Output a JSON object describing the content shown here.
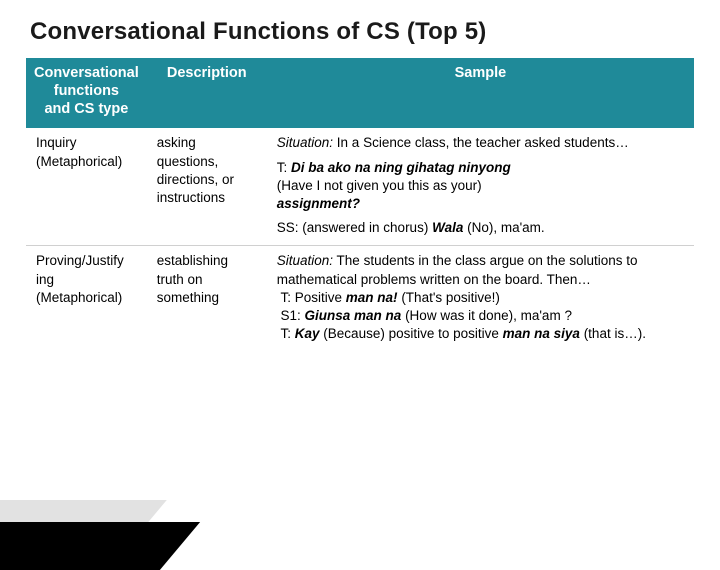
{
  "title": "Conversational Functions of CS (Top 5)",
  "headers": {
    "col1_line1": "Conversational",
    "col1_line2": "functions",
    "col1_line3": "and CS type",
    "col2": "Description",
    "col3": "Sample"
  },
  "rows": [
    {
      "func_line1": "Inquiry",
      "func_line2": "(Metaphorical)",
      "desc": "asking questions, directions, or instructions",
      "sample": {
        "sit_label": "Situation:",
        "sit_text": " In a Science class, the teacher asked students…",
        "t_label": "T: ",
        "t_bolditalic": "Di ba ako na ning gihatag ninyong",
        "paren1": "(Have I not given you this as  your)",
        "assign": "assignment?",
        "ss_label": "SS: (answered in chorus) ",
        "ss_bold": "Wala",
        "ss_rest": " (No), ma'am."
      }
    },
    {
      "func_line1": "Proving/Justify",
      "func_line2": "ing",
      "func_line3": "(Metaphorical)",
      "desc": "establishing truth on something",
      "sample": {
        "sit_label": "Situation:",
        "sit_text": " The students in the class argue on the solutions to mathematical problems written on the board. Then…",
        "l1_pre": "T: Positive ",
        "l1_bi": "man na!",
        "l1_post": " (That's positive!)",
        "l2_pre": "S1: ",
        "l2_bi": "Giunsa man na",
        "l2_post": " (How was it done), ma'am ?",
        "l3_pre": "T: ",
        "l3_bi1": "Kay",
        "l3_mid": " (Because) positive to positive ",
        "l3_bi2": "man na siya",
        "l3_post": " (that  is…)."
      }
    }
  ]
}
